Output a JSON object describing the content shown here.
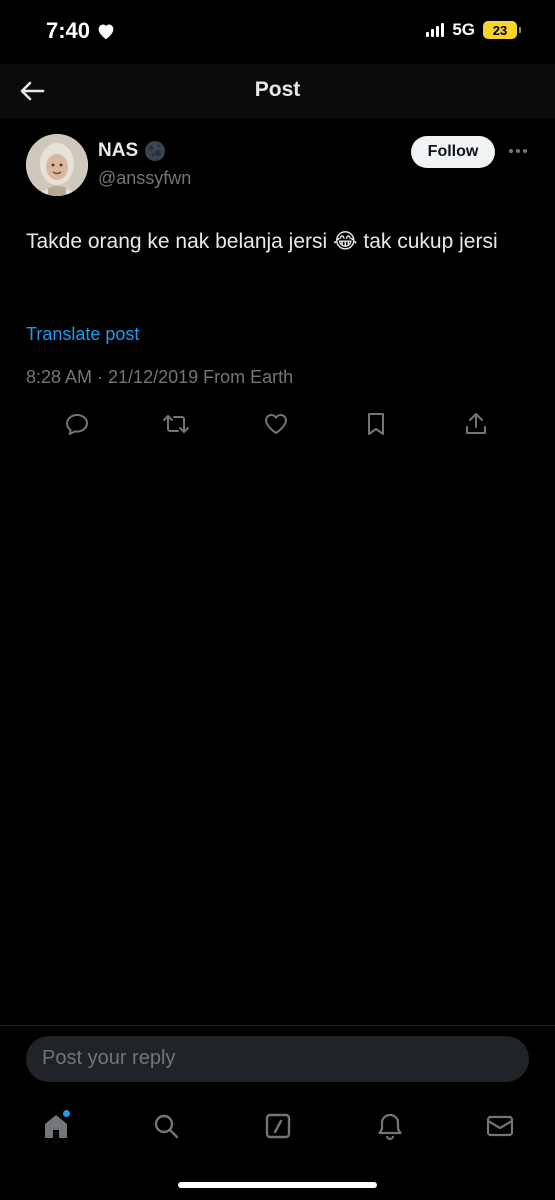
{
  "status_bar": {
    "time": "7:40",
    "network": "5G",
    "battery": "23",
    "battery_color": "#f7d52c"
  },
  "header": {
    "title": "Post",
    "back_icon": "arrow-left-icon"
  },
  "post": {
    "author_name": "NAS",
    "author_handle": "@anssyfwn",
    "follow_label": "Follow",
    "text": "Takde orang ke nak belanja jersi 😂 tak cukup jersi",
    "translate_label": "Translate post",
    "meta": "8:28 AM · 21/12/2019 From Earth",
    "actions": [
      "reply-icon",
      "repost-icon",
      "like-icon",
      "bookmark-icon",
      "share-icon"
    ]
  },
  "reply": {
    "placeholder": "Post your reply"
  },
  "tab_bar": {
    "items": [
      "home-icon",
      "search-icon",
      "compose-icon",
      "notifications-icon",
      "messages-icon"
    ],
    "accent": "#1d9bf0"
  }
}
